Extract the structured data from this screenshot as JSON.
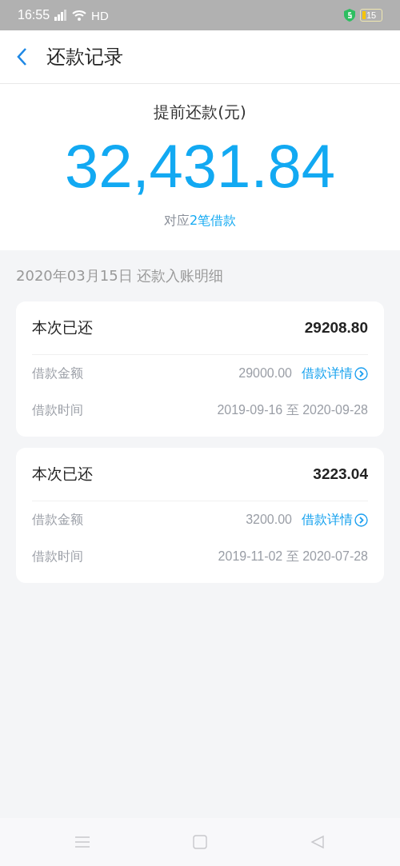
{
  "status_bar": {
    "time": "16:55",
    "network": "HD",
    "battery": "15"
  },
  "header": {
    "title": "还款记录"
  },
  "summary": {
    "label": "提前还款(元)",
    "amount": "32,431.84",
    "count_prefix": "对应",
    "count_link": "2笔借款"
  },
  "section_title": "2020年03月15日 还款入账明细",
  "records": [
    {
      "paid_label": "本次已还",
      "paid": "29208.80",
      "amount_label": "借款金额",
      "amount": "29000.00",
      "detail_link": "借款详情",
      "period_label": "借款时间",
      "period": "2019-09-16 至 2020-09-28"
    },
    {
      "paid_label": "本次已还",
      "paid": "3223.04",
      "amount_label": "借款金额",
      "amount": "3200.00",
      "detail_link": "借款详情",
      "period_label": "借款时间",
      "period": "2019-11-02 至 2020-07-28"
    }
  ]
}
